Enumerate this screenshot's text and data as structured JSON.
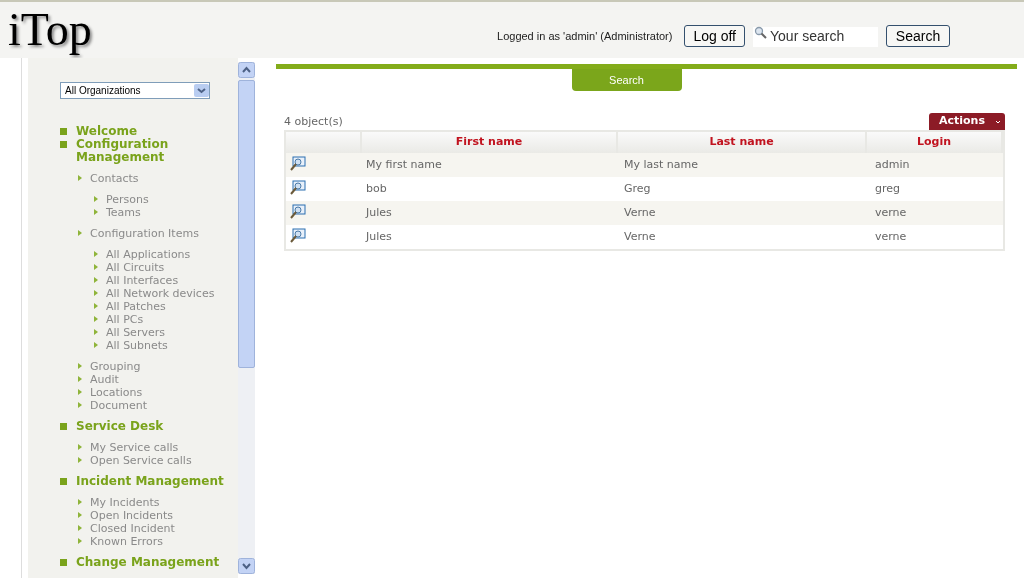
{
  "header": {
    "logo": "iTop",
    "user_info": "Logged in as 'admin' (Administrator)",
    "logoff_button": "Log off",
    "search": {
      "placeholder": "Your search"
    },
    "search_button": "Search"
  },
  "sidebar": {
    "organization_select": "All Organizations",
    "menu": [
      {
        "label": "Welcome"
      },
      {
        "label": "Configuration Management",
        "children": [
          {
            "label": "Contacts",
            "children": [
              {
                "label": "Persons"
              },
              {
                "label": "Teams"
              }
            ]
          },
          {
            "label": "Configuration Items",
            "children": [
              {
                "label": "All Applications"
              },
              {
                "label": "All Circuits"
              },
              {
                "label": "All Interfaces"
              },
              {
                "label": "All Network devices"
              },
              {
                "label": "All Patches"
              },
              {
                "label": "All PCs"
              },
              {
                "label": "All Servers"
              },
              {
                "label": "All Subnets"
              }
            ]
          },
          {
            "label": "Grouping"
          },
          {
            "label": "Audit"
          },
          {
            "label": "Locations"
          },
          {
            "label": "Document"
          }
        ]
      },
      {
        "label": "Service Desk",
        "children": [
          {
            "label": "My Service calls"
          },
          {
            "label": "Open Service calls"
          }
        ]
      },
      {
        "label": "Incident Management",
        "children": [
          {
            "label": "My Incidents"
          },
          {
            "label": "Open Incidents"
          },
          {
            "label": "Closed Incident"
          },
          {
            "label": "Known Errors"
          }
        ]
      },
      {
        "label": "Change Management"
      }
    ]
  },
  "main": {
    "search_tab": "Search",
    "count": "4 object(s)",
    "actions_button": "Actions",
    "table": {
      "columns": [
        "First name",
        "Last name",
        "Login"
      ],
      "rows": [
        [
          "My first name",
          "My last name",
          "admin"
        ],
        [
          "bob",
          "Greg",
          "greg"
        ],
        [
          "Jules",
          "Verne",
          "verne"
        ],
        [
          "Jules",
          "Verne",
          "verne"
        ]
      ]
    }
  }
}
